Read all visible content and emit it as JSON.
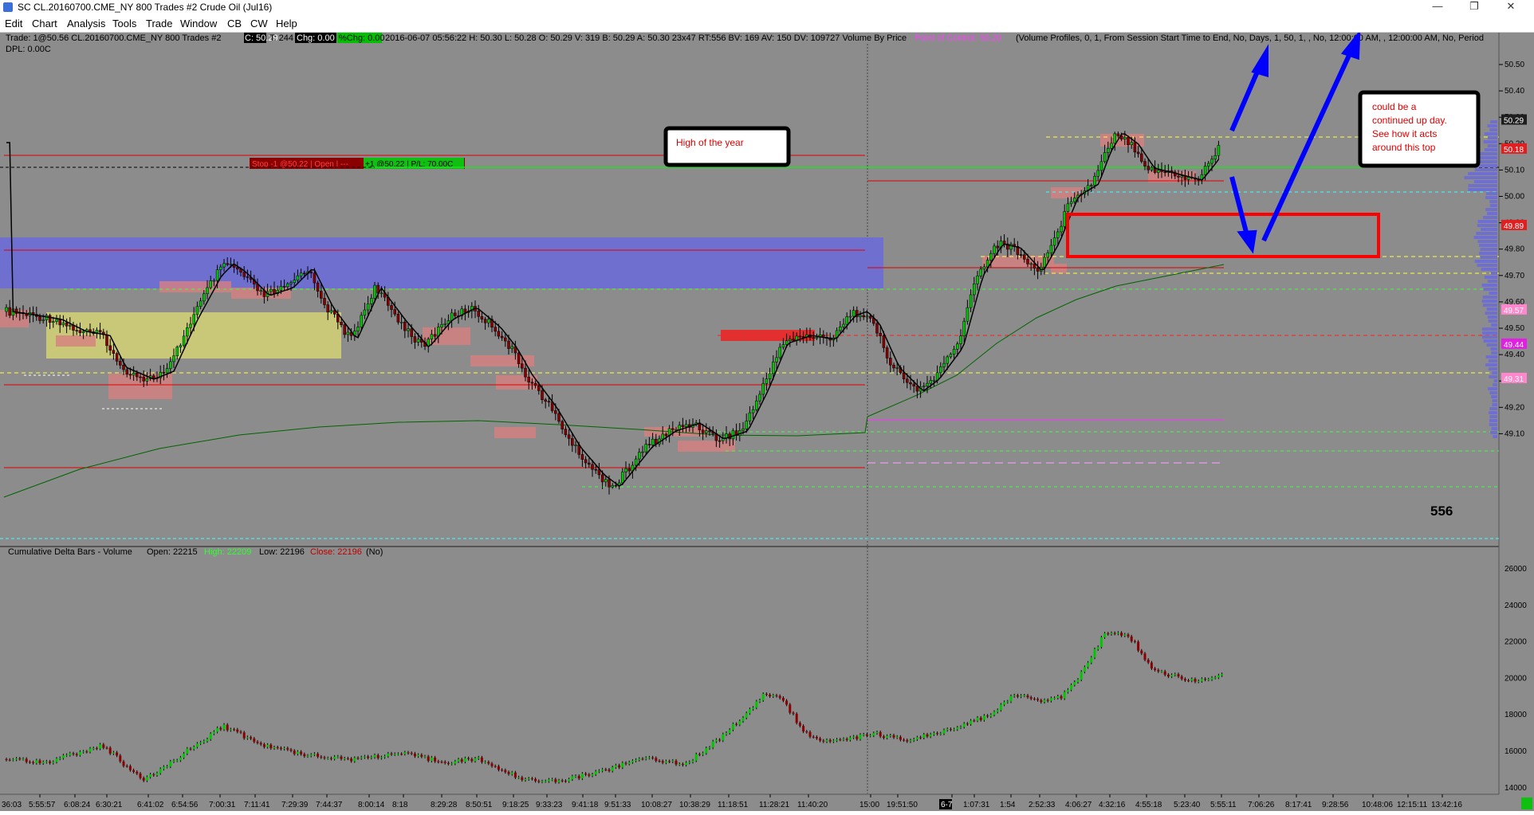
{
  "window": {
    "title": "SC CL.20160700.CME_NY  800 Trades  #2  Crude Oil (Jul16)",
    "minimize_glyph": "—",
    "maximize_glyph": "❐",
    "close_glyph": "✕"
  },
  "menu": [
    "Edit",
    "Chart",
    "Analysis",
    "Tools",
    "Trade",
    "Window",
    "CB",
    "CW",
    "Help"
  ],
  "header": {
    "prefix": "Trade: 1@50.56  CL.20160700.CME_NY  800 Trades  #2",
    "c_badge": "C: 50.29",
    "t_label": "T: 244",
    "chg_badge": "Chg: 0.00",
    "pchg_badge": "%Chg: 0.00",
    "stats": "2016-06-07 05:56:22 H: 50.30 L: 50.28 O: 50.29 V: 319 B: 50.29 A: 50.30 23x47 RT:556 BV: 169 AV: 150 DV: 109727 Volume By Price",
    "poc": "Point of Control: 50.20",
    "profile": "(Volume Profiles, 0, 1, From Session Start Time to End, No, Days, 1, 50, 1, , No, 12:00:00 AM, , 12:00:00 AM, No, Period",
    "dpl": "DPL: 0.00C"
  },
  "order_line": {
    "label_left": "Stop -1 @50.22 | Open | ---",
    "label_right": "+1 @50.22 | P/L: 70.00C"
  },
  "annotations": {
    "high_of_year": "High of the year",
    "continued_up_day": [
      "could be a",
      "continued up day.",
      "See how it acts",
      "around this top"
    ],
    "count": "556"
  },
  "price_axis": {
    "ticks": [
      "50.50",
      "50.40",
      "50.30",
      "50.20",
      "50.10",
      "50.00",
      "49.90",
      "49.80",
      "49.70",
      "49.60",
      "49.50",
      "49.40",
      "49.30",
      "49.20",
      "49.10"
    ],
    "badges": [
      {
        "text": "50.29",
        "color": "#1e1e1e",
        "fg": "#ffffff"
      },
      {
        "text": "50.18",
        "color": "#e02020",
        "fg": "#ffffff"
      },
      {
        "text": "49.89",
        "color": "#e02020",
        "fg": "#ffffff"
      },
      {
        "text": "49.57",
        "color": "#ff88cc",
        "fg": "#ffffff"
      },
      {
        "text": "49.44",
        "color": "#e020e0",
        "fg": "#ffffff"
      },
      {
        "text": "49.31",
        "color": "#ff88cc",
        "fg": "#ffffff"
      }
    ]
  },
  "delta_panel": {
    "title": "Cumulative Delta Bars - Volume",
    "open": "Open: 22215",
    "high": "High: 22209",
    "low": "Low: 22196",
    "close": "Close: 22196",
    "no": "(No)",
    "ticks": [
      "26000",
      "24000",
      "22000",
      "20000",
      "18000",
      "16000",
      "14000"
    ]
  },
  "time_axis": [
    "5:55:57",
    "6:08:24",
    "6:30:21",
    "6:41:02",
    "6:54:56",
    "7:00:31",
    "7:11:41",
    "7:29:39",
    "7:44:37",
    "8:00:14",
    "8:18",
    "8:29:28",
    "8:50:51",
    "9:18:25",
    "9:33:23",
    "9:41:18",
    "9:51:33",
    "10:08:27",
    "10:38:29",
    "11:18:51",
    "11:28:21",
    "11:40:20",
    "15:00",
    "19:51:50",
    "6-7",
    "1:07:31",
    "1:54",
    "2:52:33",
    "4:06:27",
    "4:32:16",
    "4:55:18",
    "5:23:40",
    "5:55:11",
    "7:06:26",
    "8:17:41",
    "9:28:56",
    "10:48:06",
    "12:15:11",
    "13:42:16"
  ],
  "time_axis_first": "36:03",
  "colors": {
    "chart_bg": "#8c8c8c",
    "up_candle": "#00c800",
    "down_candle": "#8b0000",
    "arrow": "#0000ff",
    "box": "#ff0000",
    "va_band": "#6f6fd0",
    "yellow_zone": "#c8c878"
  }
}
